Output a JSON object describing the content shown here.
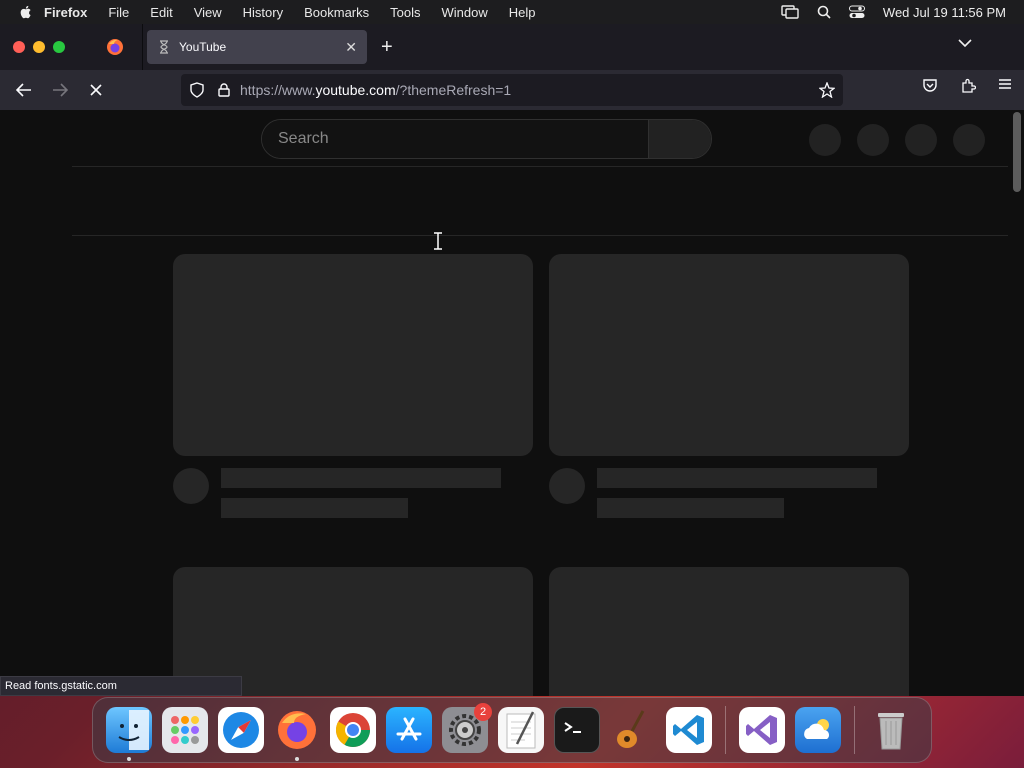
{
  "menubar": {
    "app": "Firefox",
    "items": [
      "File",
      "Edit",
      "View",
      "History",
      "Bookmarks",
      "Tools",
      "Window",
      "Help"
    ],
    "clock": "Wed Jul 19  11:56 PM"
  },
  "browser": {
    "tab_title": "YouTube",
    "url_prefix": "https://www.",
    "url_domain": "youtube.com",
    "url_suffix": "/?themeRefresh=1",
    "status_text": "Read fonts.gstatic.com"
  },
  "page": {
    "search_placeholder": "Search"
  },
  "dock": {
    "apps": [
      "Finder",
      "Launchpad",
      "Safari",
      "Firefox",
      "Chrome",
      "App Store",
      "System Settings",
      "TextEdit",
      "Terminal",
      "GarageBand",
      "VS Code",
      "Visual Studio",
      "Weather",
      "Trash"
    ],
    "settings_badge": "2"
  },
  "colors": {
    "page_bg": "#0f0f0f",
    "skeleton": "#262626",
    "toolbar": "#2b2a33"
  }
}
